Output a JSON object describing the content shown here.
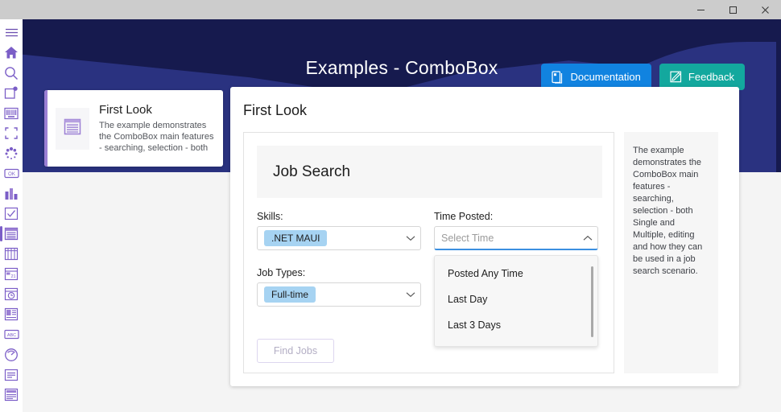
{
  "window": {
    "titlebar_buttons": [
      {
        "name": "minimize",
        "glyph": "minimize-icon"
      },
      {
        "name": "maximize",
        "glyph": "maximize-icon"
      },
      {
        "name": "close",
        "glyph": "close-icon"
      }
    ]
  },
  "colors": {
    "header_dark": "#161a4e",
    "header_blue": "#2a3280",
    "doc_button": "#1183e0",
    "feedback_button": "#13a89e",
    "accent_purple": "#7b5ec7",
    "chip_blue": "#a6d3f2",
    "focus_underline": "#3b8fe0"
  },
  "rail": {
    "items": [
      {
        "name": "hamburger-menu-icon",
        "label": "Menu"
      },
      {
        "name": "home-icon",
        "label": "Home"
      },
      {
        "name": "search-icon",
        "label": "Search"
      },
      {
        "name": "badge-icon",
        "label": "Badge"
      },
      {
        "name": "barcode-icon",
        "label": "Barcode"
      },
      {
        "name": "border-icon",
        "label": "Border"
      },
      {
        "name": "busy-indicator-icon",
        "label": "Busy Indicator"
      },
      {
        "name": "button-icon",
        "label": "Button"
      },
      {
        "name": "chart-icon",
        "label": "Chart"
      },
      {
        "name": "checkbox-icon",
        "label": "CheckBox"
      },
      {
        "name": "combobox-icon",
        "label": "ComboBox"
      },
      {
        "name": "datagrid-icon",
        "label": "DataGrid"
      },
      {
        "name": "calendar-icon",
        "label": "Calendar"
      },
      {
        "name": "date-time-picker-icon",
        "label": "Date Time Picker"
      },
      {
        "name": "dock-layout-icon",
        "label": "Dock Layout"
      },
      {
        "name": "entry-icon",
        "label": "Entry"
      },
      {
        "name": "gauge-icon",
        "label": "Gauge"
      },
      {
        "name": "listview-icon",
        "label": "ListView"
      },
      {
        "name": "navigation-drawer-icon",
        "label": "Navigation Drawer"
      }
    ],
    "active_index": 10
  },
  "header": {
    "title": "Examples - ComboBox",
    "documentation_button": "Documentation",
    "feedback_button": "Feedback",
    "documentation_icon": "book-icon",
    "feedback_icon": "pencil-square-icon"
  },
  "example_card": {
    "icon": "article-icon",
    "title": "First Look",
    "description": "The example demonstrates the ComboBox main features - searching, selection - both"
  },
  "main": {
    "title": "First Look",
    "description": "The example demonstrates the ComboBox main features - searching, selection - both Single and Multiple, editing and how they can be used in a job search scenario."
  },
  "form": {
    "heading": "Job Search",
    "skills": {
      "label": "Skills:",
      "chip": ".NET MAUI",
      "caret_icon": "chevron-down-icon"
    },
    "job_types": {
      "label": "Job Types:",
      "chip": "Full-time",
      "caret_icon": "chevron-down-icon"
    },
    "time_posted": {
      "label": "Time Posted:",
      "placeholder": "Select Time",
      "value": "",
      "caret_icon": "chevron-up-icon",
      "expanded": true,
      "options": [
        "Posted Any Time",
        "Last Day",
        "Last 3 Days"
      ]
    },
    "submit_button": "Find Jobs"
  }
}
